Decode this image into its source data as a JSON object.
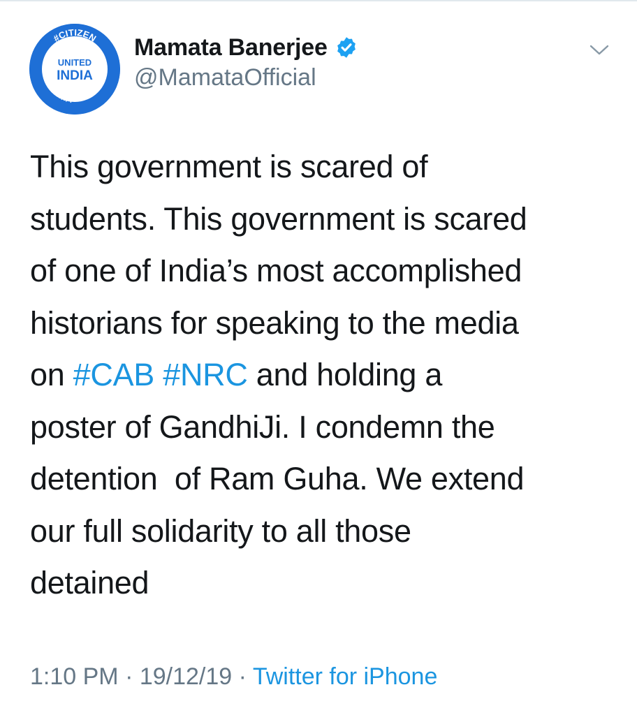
{
  "author": {
    "display_name": "Mamata Banerjee",
    "handle": "@MamataOfficial",
    "verified": true,
    "avatar": {
      "badge_top": "#CITIZEN",
      "badge_mid1": "UNITED",
      "badge_mid2": "INDIA",
      "badge_bottom": "নাগরিক",
      "ring_color": "#1e6fd6"
    }
  },
  "menu": {
    "icon": "chevron-down-icon"
  },
  "tweet": {
    "lines": [
      {
        "text": "This government is scared of"
      },
      {
        "text": "students. This government is scared"
      },
      {
        "text": "of one of India’s most accomplished"
      },
      {
        "text": "historians for speaking to the media"
      },
      {
        "before": "on ",
        "tag1": "#CAB",
        "between": " ",
        "tag2": "#NRC",
        "after": " and holding a"
      },
      {
        "text": "poster of GandhiJi. I condemn the"
      },
      {
        "text": "detention  of Ram Guha. We extend"
      },
      {
        "text": "our full solidarity to all those"
      },
      {
        "text": "detained"
      }
    ]
  },
  "meta": {
    "time": "1:10 PM",
    "date": "19/12/19",
    "separator": " · ",
    "source": "Twitter for iPhone"
  },
  "colors": {
    "link": "#1b95e0",
    "secondary_text": "#657786",
    "primary_text": "#14171a",
    "verified_badge": "#1da1f2"
  }
}
